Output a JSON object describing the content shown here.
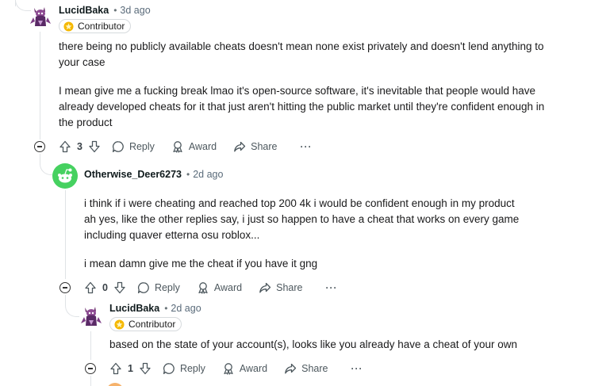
{
  "comments": [
    {
      "author": "LucidBaka",
      "separator": "•",
      "time": "3d ago",
      "flair": "Contributor",
      "body": [
        "there being no publicly available cheats doesn't mean none exist privately and doesn't lend anything to",
        "your case",
        "",
        "I mean give me a fucking break lmao it's open-source software, it's inevitable that people would have",
        "already developed cheats for it that just aren't hitting the public market until they're confident enough in",
        "the product"
      ],
      "votes": "3",
      "reply_label": "Reply",
      "award_label": "Award",
      "share_label": "Share",
      "more_label": "···"
    },
    {
      "author": "Otherwise_Deer6273",
      "separator": "•",
      "time": "2d ago",
      "body": [
        "i think if i were cheating and reached top 200 4k i would be confident enough in my product",
        "ah yes, like the other replies say, i just so happen to have a cheat that works on every game",
        "including quaver etterna osu roblox...",
        "",
        "i mean damn give me the cheat if you have it gng"
      ],
      "votes": "0",
      "reply_label": "Reply",
      "award_label": "Award",
      "share_label": "Share",
      "more_label": "···"
    },
    {
      "author": "LucidBaka",
      "separator": "•",
      "time": "2d ago",
      "flair": "Contributor",
      "body": [
        "based on the state of your account(s), looks like you already have a cheat of your own"
      ],
      "votes": "1",
      "reply_label": "Reply",
      "award_label": "Award",
      "share_label": "Share",
      "more_label": "···"
    }
  ],
  "colors": {
    "time": "#5a6b7a",
    "thread_line": "#e0e3e6",
    "flair_star": "#f5b800",
    "snoo_bg": "#46d160"
  },
  "icons": {
    "upvote": "upvote-arrow-icon",
    "downvote": "downvote-arrow-icon",
    "reply": "speech-bubble-icon",
    "award": "award-ribbon-icon",
    "share": "share-arrow-icon",
    "collapse": "collapse-minus-icon"
  }
}
